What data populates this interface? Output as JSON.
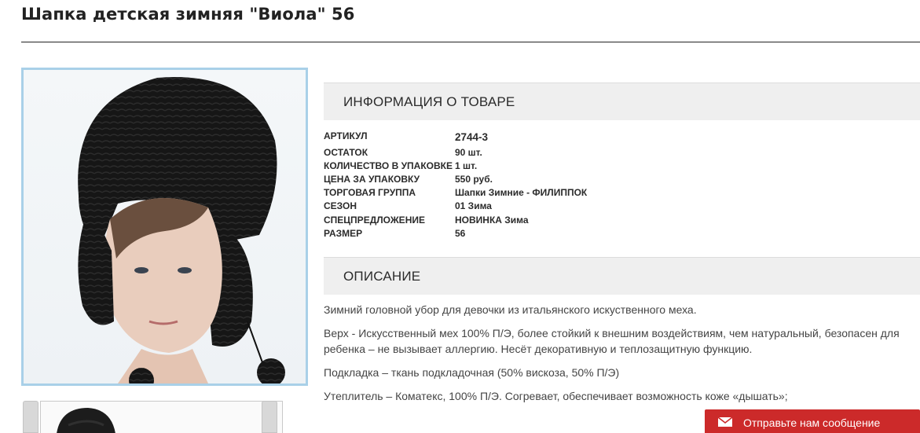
{
  "product": {
    "title": "Шапка детская зимняя \"Виола\" 56"
  },
  "info_section": {
    "heading": "ИНФОРМАЦИЯ О ТОВАРЕ",
    "rows": [
      {
        "label": "АРТИКУЛ",
        "value": "2744-3"
      },
      {
        "label": "ОСТАТОК",
        "value": "90 шт."
      },
      {
        "label": "КОЛИЧЕСТВО В УПАКОВКЕ",
        "value": "1 шт."
      },
      {
        "label": "ЦЕНА ЗА УПАКОВКУ",
        "value": "550 руб."
      },
      {
        "label": "ТОРГОВАЯ ГРУППА",
        "value": "Шапки Зимние - ФИЛИППОК"
      },
      {
        "label": "СЕЗОН",
        "value": "01 Зима"
      },
      {
        "label": "СПЕЦПРЕДЛОЖЕНИЕ",
        "value": "НОВИНКА Зима"
      },
      {
        "label": "РАЗМЕР",
        "value": "56"
      }
    ]
  },
  "description_section": {
    "heading": "ОПИСАНИЕ",
    "paragraphs": [
      "Зимний головной убор для девочки из итальянского искуственного меха.",
      "Верх - Искусственный мех 100% П/Э, более стойкий к внешним воздействиям, чем натуральный, безопасен для ребенка – не вызывает аллергию. Несёт декоративную и теплозащитную функцию.",
      "Подкладка – ткань подкладочная (50% вискоза, 50% П/Э)",
      "Утеплитель – Коматекс, 100% П/Э. Согревает, обеспечивает возможность коже «дышать»;"
    ]
  },
  "chat": {
    "button_label": "Отправьте нам сообщение",
    "icon": "envelope-icon",
    "color": "#cc2a2a"
  },
  "gallery": {
    "main_image": "product-photo-girl-in-black-fur-hat",
    "thumbnails": [
      "thumbnail-hat"
    ]
  }
}
